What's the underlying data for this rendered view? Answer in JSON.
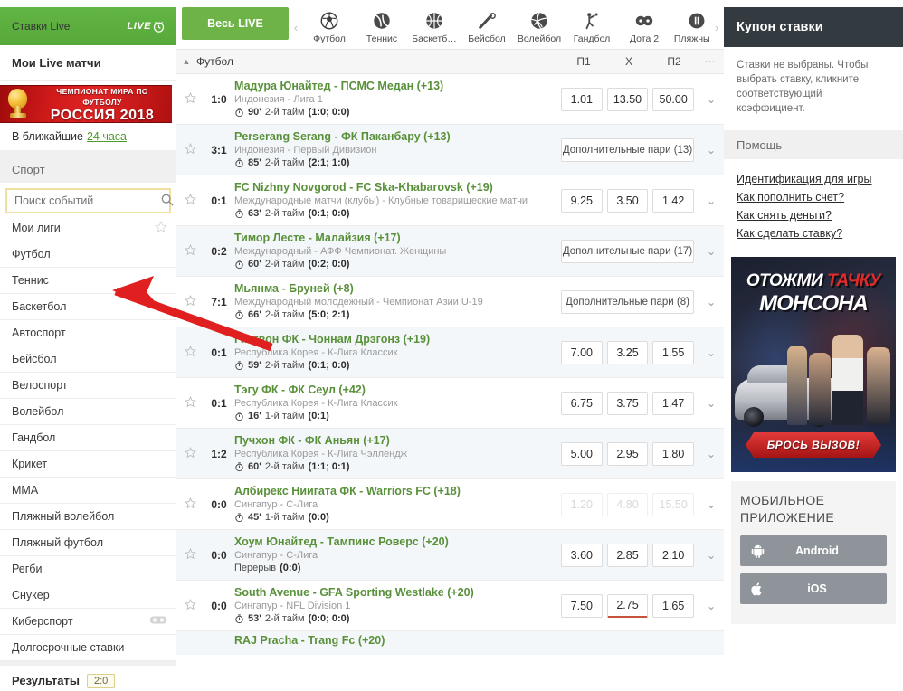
{
  "sidebar": {
    "header_title": "Ставки Live",
    "live_badge": "LIVE",
    "my_live": "Мои Live матчи",
    "wc_banner": {
      "line1": "ЧЕМПИОНАТ МИРА ПО ФУТБОЛУ",
      "line2": "РОССИЯ 2018"
    },
    "soon_label": "В ближайшие",
    "soon_link": "24 часа",
    "sport_header": "Спорт",
    "search_placeholder": "Поиск событий",
    "search_value": "",
    "items": [
      {
        "label": "Мои лиги",
        "icon": "star-icon"
      },
      {
        "label": "Футбол",
        "icon": ""
      },
      {
        "label": "Теннис",
        "icon": ""
      },
      {
        "label": "Баскетбол",
        "icon": ""
      },
      {
        "label": "Автоспорт",
        "icon": ""
      },
      {
        "label": "Бейсбол",
        "icon": ""
      },
      {
        "label": "Велоспорт",
        "icon": ""
      },
      {
        "label": "Волейбол",
        "icon": ""
      },
      {
        "label": "Гандбол",
        "icon": ""
      },
      {
        "label": "Крикет",
        "icon": ""
      },
      {
        "label": "ММА",
        "icon": ""
      },
      {
        "label": "Пляжный волейбол",
        "icon": ""
      },
      {
        "label": "Пляжный футбол",
        "icon": ""
      },
      {
        "label": "Регби",
        "icon": ""
      },
      {
        "label": "Снукер",
        "icon": ""
      },
      {
        "label": "Киберспорт",
        "icon": "gamepad-icon"
      },
      {
        "label": "Долгосрочные ставки",
        "icon": ""
      }
    ],
    "results_label": "Результаты",
    "results_badge": "2:0"
  },
  "topbar": {
    "all_live": "Весь LIVE",
    "prev_arrow": "‹",
    "next_arrow": "›",
    "sports": [
      {
        "label": "Футбол",
        "icon": "soccer-ball-icon"
      },
      {
        "label": "Теннис",
        "icon": "tennis-ball-icon"
      },
      {
        "label": "Баскетб…",
        "icon": "basketball-icon"
      },
      {
        "label": "Бейсбол",
        "icon": "baseball-bat-icon"
      },
      {
        "label": "Волейбол",
        "icon": "volleyball-icon"
      },
      {
        "label": "Гандбол",
        "icon": "handball-player-icon"
      },
      {
        "label": "Дота 2",
        "icon": "dota-icon"
      },
      {
        "label": "Пляжны…",
        "icon": "beach-icon"
      }
    ]
  },
  "table": {
    "section_title": "Футбол",
    "columns": [
      "П1",
      "X",
      "П2"
    ],
    "more": "⋯",
    "rows": [
      {
        "score": "1:0",
        "teams": "Мадура Юнайтед - ПСМС Медан (+13)",
        "league": "Индонезия - Лига 1",
        "minute": "90'",
        "phase": "2-й тайм",
        "periods": "(1:0; 0:0)",
        "odds": [
          "1.01",
          "13.50",
          "50.00"
        ],
        "extra": null,
        "alt": false
      },
      {
        "score": "3:1",
        "teams": "Perserang Serang - ФК Паканбару (+13)",
        "league": "Индонезия - Первый Дивизион",
        "minute": "85'",
        "phase": "2-й тайм",
        "periods": "(2:1; 1:0)",
        "odds": null,
        "extra": "Дополнительные пари (13)",
        "alt": true
      },
      {
        "score": "0:1",
        "teams": "FC Nizhny Novgorod - FC Ska-Khabarovsk (+19)",
        "league": "Международные матчи (клубы) - Клубные товарищеские матчи",
        "minute": "63'",
        "phase": "2-й тайм",
        "periods": "(0:1; 0:0)",
        "odds": [
          "9.25",
          "3.50",
          "1.42"
        ],
        "extra": null,
        "alt": false
      },
      {
        "score": "0:2",
        "teams": "Тимор Лесте - Малайзия (+17)",
        "league": "Международный - АФФ Чемпионат. Женщины",
        "minute": "60'",
        "phase": "2-й тайм",
        "periods": "(0:2; 0:0)",
        "odds": null,
        "extra": "Дополнительные пари (17)",
        "alt": true
      },
      {
        "score": "7:1",
        "teams": "Мьянма - Бруней (+8)",
        "league": "Международный молодежный - Чемпионат Азии U-19",
        "minute": "66'",
        "phase": "2-й тайм",
        "periods": "(5:0; 2:1)",
        "odds": null,
        "extra": "Дополнительные пари (8)",
        "alt": false
      },
      {
        "score": "0:1",
        "teams": "Гангвон ФК - Чоннам Дрэгонз (+19)",
        "league": "Республика Корея - К-Лига Классик",
        "minute": "59'",
        "phase": "2-й тайм",
        "periods": "(0:1; 0:0)",
        "odds": [
          "7.00",
          "3.25",
          "1.55"
        ],
        "extra": null,
        "alt": true
      },
      {
        "score": "0:1",
        "teams": "Тэгу ФК - ФК Сеул (+42)",
        "league": "Республика Корея - К-Лига Классик",
        "minute": "16'",
        "phase": "1-й тайм",
        "periods": "(0:1)",
        "odds": [
          "6.75",
          "3.75",
          "1.47"
        ],
        "extra": null,
        "alt": false
      },
      {
        "score": "1:2",
        "teams": "Пучхон ФК - ФК Аньян (+17)",
        "league": "Республика Корея - К-Лига Чэллендж",
        "minute": "60'",
        "phase": "2-й тайм",
        "periods": "(1:1; 0:1)",
        "odds": [
          "5.00",
          "2.95",
          "1.80"
        ],
        "extra": null,
        "alt": true
      },
      {
        "score": "0:0",
        "teams": "Албирекс Ниигата ФК - Warriors FC (+18)",
        "league": "Сингапур - С-Лига",
        "minute": "45'",
        "phase": "1-й тайм",
        "periods": "(0:0)",
        "odds": [
          "1.20",
          "4.80",
          "15.50"
        ],
        "odds_dim": true,
        "extra": null,
        "alt": false
      },
      {
        "score": "0:0",
        "teams": "Хоум Юнайтед - Тампинс Роверс (+20)",
        "league": "Сингапур - С-Лига",
        "minute": "",
        "phase": "Перерыв",
        "periods": "(0:0)",
        "odds": [
          "3.60",
          "2.85",
          "2.10"
        ],
        "extra": null,
        "alt": true
      },
      {
        "score": "0:0",
        "teams": "South Avenue - GFA Sporting Westlake (+20)",
        "league": "Сингапур - NFL Division 1",
        "minute": "53'",
        "phase": "2-й тайм",
        "periods": "(0:0; 0:0)",
        "odds": [
          "7.50",
          "2.75",
          "1.65"
        ],
        "odds_down_index": 1,
        "extra": null,
        "alt": false
      },
      {
        "score": "",
        "teams": "RAJ Pracha - Trang Fc (+20)",
        "league": "",
        "minute": "",
        "phase": "",
        "periods": "",
        "odds": null,
        "extra": null,
        "alt": true
      }
    ]
  },
  "right": {
    "coupon_title": "Купон ставки",
    "coupon_empty": "Ставки не выбраны. Чтобы выбрать ставку, кликните соответствующий коэффициент.",
    "help_title": "Помощь",
    "help_links": [
      "Идентификация для игры",
      "Как пополнить счет?",
      "Как снять деньги?",
      "Как сделать ставку?"
    ],
    "promo": {
      "line1a": "ОТОЖМИ",
      "line1b": "ТАЧКУ",
      "line2": "МОНСОНА",
      "cta": "БРОСЬ ВЫЗОВ!"
    },
    "mobile_title": "МОБИЛЬНОЕ ПРИЛОЖЕНИЕ",
    "apps": [
      {
        "label": "Android",
        "icon": "android-icon"
      },
      {
        "label": "iOS",
        "icon": "apple-icon"
      }
    ]
  },
  "colors": {
    "brand_green": "#62b544",
    "odds_green": "#59913a",
    "coupon_dark": "#333a40",
    "banner_red": "#d11a1a",
    "arrow_red": "#e02020"
  }
}
